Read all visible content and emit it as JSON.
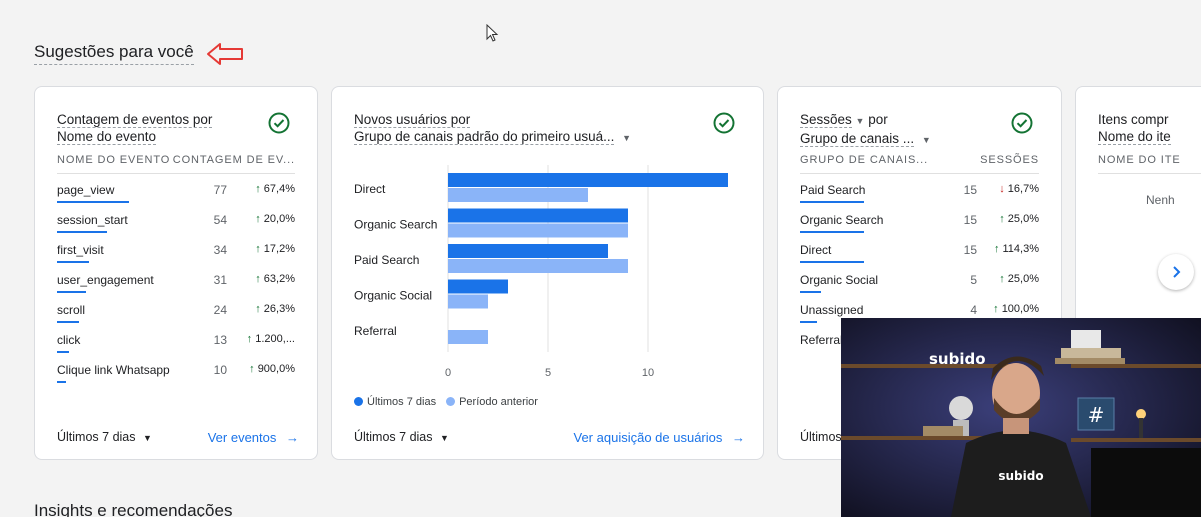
{
  "section_title": "Sugestões para você",
  "insights_title": "Insights e recomendações",
  "colors": {
    "primary": "#1a73e8",
    "secondary": "#8ab4f8",
    "positive": "#137333",
    "negative": "#c5221f",
    "annotation": "#e53935"
  },
  "card_events": {
    "title_line1": "Contagem de eventos por",
    "title_line2": "Nome do evento",
    "col_name": "NOME DO EVENTO",
    "col_value": "CONTAGEM DE EV...",
    "rows": [
      {
        "name": "page_view",
        "value": "77",
        "change": "67,4%",
        "dir": "up",
        "frac": 1.0
      },
      {
        "name": "session_start",
        "value": "54",
        "change": "20,0%",
        "dir": "up",
        "frac": 0.7
      },
      {
        "name": "first_visit",
        "value": "34",
        "change": "17,2%",
        "dir": "up",
        "frac": 0.44
      },
      {
        "name": "user_engagement",
        "value": "31",
        "change": "63,2%",
        "dir": "up",
        "frac": 0.4
      },
      {
        "name": "scroll",
        "value": "24",
        "change": "26,3%",
        "dir": "up",
        "frac": 0.31
      },
      {
        "name": "click",
        "value": "13",
        "change": "1.200,...",
        "dir": "up",
        "frac": 0.17
      },
      {
        "name": "Clique link Whatsapp",
        "value": "10",
        "change": "900,0%",
        "dir": "up",
        "frac": 0.13
      }
    ],
    "range": "Últimos 7 dias",
    "link": "Ver eventos"
  },
  "card_users": {
    "title_line1": "Novos usuários por",
    "title_line2": "Grupo de canais padrão do primeiro usuá...",
    "legend_current": "Últimos 7 dias",
    "legend_previous": "Período anterior",
    "range": "Últimos 7 dias",
    "link": "Ver aquisição de usuários"
  },
  "chart_data": {
    "type": "bar",
    "orientation": "horizontal",
    "categories": [
      "Direct",
      "Organic Search",
      "Paid Search",
      "Organic Social",
      "Referral"
    ],
    "series": [
      {
        "name": "Últimos 7 dias",
        "values": [
          14,
          9,
          8,
          3,
          0
        ]
      },
      {
        "name": "Período anterior",
        "values": [
          7,
          9,
          9,
          2,
          2
        ]
      }
    ],
    "xlim": [
      0,
      14
    ],
    "xticks": [
      "0",
      "5",
      "10"
    ],
    "grid": true,
    "legend": "bottom"
  },
  "card_sessions": {
    "title_line1": "Sessões",
    "title_line1b": "por",
    "title_line2": "Grupo de canais ...",
    "col_name": "GRUPO DE CANAIS...",
    "col_value": "SESSÕES",
    "rows": [
      {
        "name": "Paid Search",
        "value": "15",
        "change": "16,7%",
        "dir": "down",
        "frac": 1.0
      },
      {
        "name": "Organic Search",
        "value": "15",
        "change": "25,0%",
        "dir": "up",
        "frac": 1.0
      },
      {
        "name": "Direct",
        "value": "15",
        "change": "114,3%",
        "dir": "up",
        "frac": 1.0
      },
      {
        "name": "Organic Social",
        "value": "5",
        "change": "25,0%",
        "dir": "up",
        "frac": 0.33
      },
      {
        "name": "Unassigned",
        "value": "4",
        "change": "100,0%",
        "dir": "up",
        "frac": 0.27
      },
      {
        "name": "Referral",
        "value": "",
        "change": "",
        "dir": "up",
        "frac": 0.0
      }
    ],
    "range": "Últimos"
  },
  "card_items": {
    "title_line1": "Itens compr",
    "title_line2": "Nome do ite",
    "col_name": "NOME DO ITE",
    "empty": "Nenh"
  },
  "webcam": {
    "brand": "subido",
    "shirt": "subido",
    "hash": "#"
  }
}
